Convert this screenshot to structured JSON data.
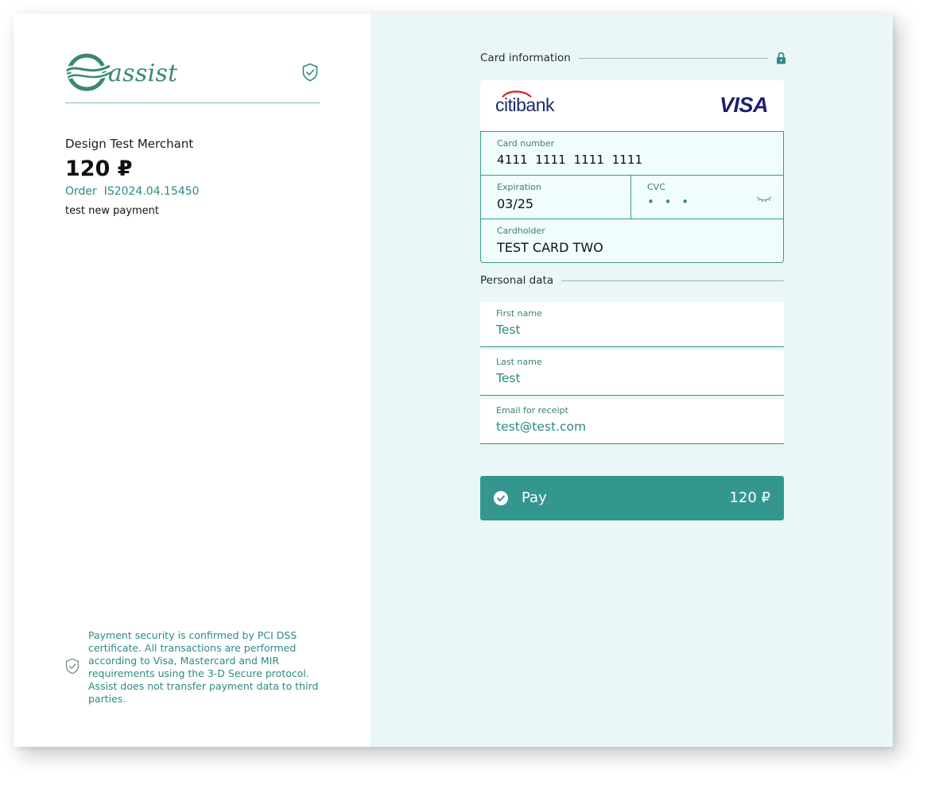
{
  "brand": {
    "logo_text": "assist"
  },
  "merchant": {
    "name": "Design Test Merchant",
    "amount": "120 ₽",
    "order": "Order  IS2024.04.15450",
    "description": "test new payment"
  },
  "security_note": "Payment security is confirmed by PCI DSS certificate. All transactions are performed according to Visa, Mastercard and MIR requirements using the 3-D Secure protocol. Assist does not transfer payment data to third parties.",
  "card_section": {
    "title": "Card information",
    "bank": "citibank",
    "network": "VISA",
    "card_number": {
      "label": "Card number",
      "value": "4111  1111  1111  1111"
    },
    "expiration": {
      "label": "Expiration",
      "value": "03/25"
    },
    "cvc": {
      "label": "CVC",
      "value": "• • •"
    },
    "cardholder": {
      "label": "Cardholder",
      "value": "TEST CARD TWO"
    }
  },
  "personal_section": {
    "title": "Personal data",
    "first_name": {
      "label": "First name",
      "value": "Test"
    },
    "last_name": {
      "label": "Last name",
      "value": "Test"
    },
    "email": {
      "label": "Email for receipt",
      "value": "test@test.com"
    }
  },
  "pay_button": {
    "label": "Pay",
    "amount": "120 ₽"
  },
  "icons": {
    "logo": "assist-wave-logo",
    "shield": "shield-check-icon",
    "lock": "lock-icon",
    "eye": "eye-closed-icon",
    "check": "check-circle-icon"
  },
  "colors": {
    "accent": "#33978f",
    "accent_text": "#2d8a85",
    "right_bg": "#ebf6f6",
    "brand_green": "#3a8a6c",
    "card_brand": "#1a1f71"
  }
}
